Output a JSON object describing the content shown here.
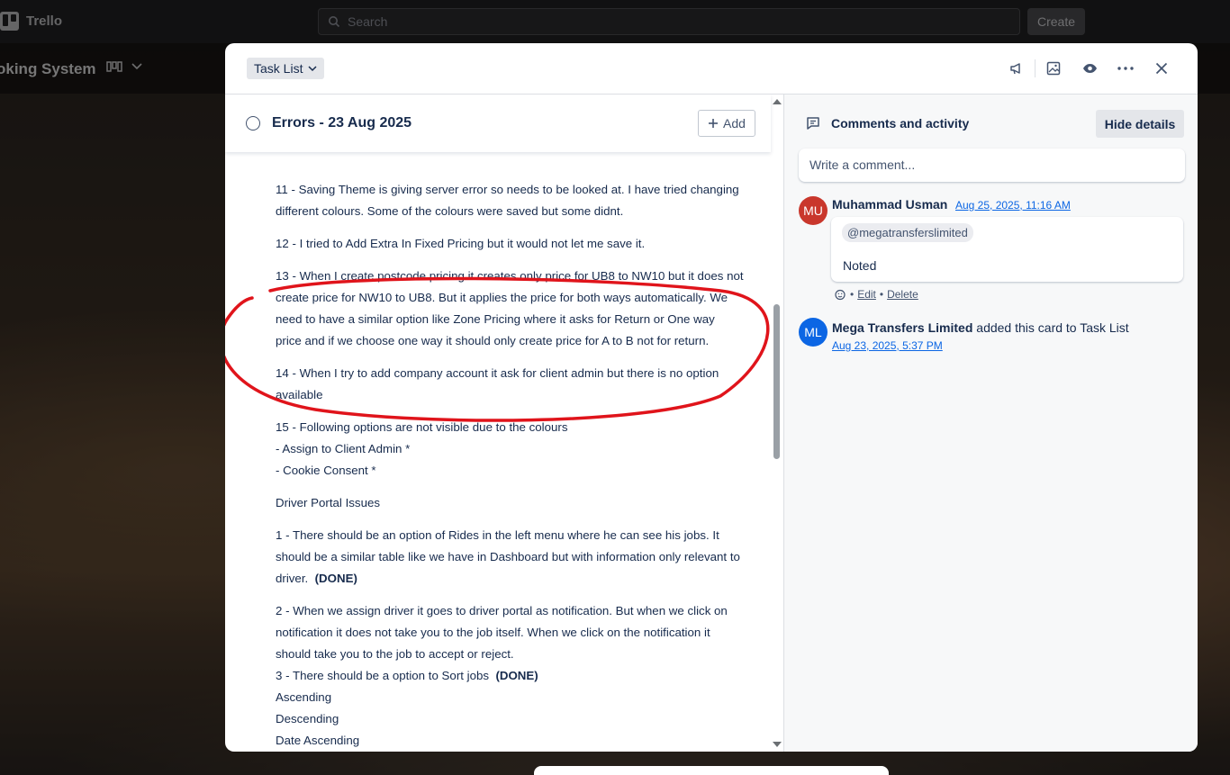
{
  "app": {
    "name": "Trello",
    "search_placeholder": "Search",
    "create_label": "Create"
  },
  "board": {
    "title": "oking System"
  },
  "modal": {
    "list_name": "Task List",
    "card_title": "Errors - 23 Aug 2025",
    "add_label": "Add",
    "description": {
      "p11": "11 - Saving Theme is giving server error so needs to be looked at. I have tried changing different colours. Some of the colours were saved but some didnt.",
      "p12": "12 - I tried to Add Extra In Fixed Pricing but it would not let me save it.",
      "p13": "13 - When I create postcode pricing it creates only price for UB8 to NW10 but it does not create price for NW10 to UB8. But it applies the price for both ways automatically. We need to have a similar option like Zone Pricing where it asks for Return or One way price and if we choose one way it should only create price for A to B not for return.",
      "p14": "14 - When I try to add company account it ask for client admin but there is no option available",
      "p15": "15 - Following options are not visible due to the colours",
      "p15a": "- Assign to Client Admin *",
      "p15b": "- Cookie Consent *",
      "driver_heading": "Driver Portal Issues",
      "d1": "1 - There should be an option of Rides in the left menu where he can see his jobs. It should be a similar table like we have in Dashboard but with information only relevant to driver.",
      "d1_done": "(DONE)",
      "d2": "2 - When we assign driver it goes to driver portal as notification. But when we click on notification it does not take you to the job itself. When we click on the notification it should take you to the job to accept or reject.",
      "d3": "3 - There should be a option to Sort jobs",
      "d3_done": "(DONE)",
      "sort1": "Ascending",
      "sort2": "Descending",
      "sort3": "Date Ascending"
    },
    "activity": {
      "heading": "Comments and activity",
      "hide_label": "Hide details",
      "comment_placeholder": "Write a comment...",
      "comment": {
        "initials": "MU",
        "author": "Muhammad Usman",
        "date": "Aug 25, 2025, 11:16 AM",
        "mention": "@megatransferslimited",
        "text": "Noted",
        "edit": "Edit",
        "delete": "Delete"
      },
      "event": {
        "initials": "ML",
        "actor": "Mega Transfers Limited",
        "action": "added this card to Task List",
        "date": "Aug 23, 2025, 5:37 PM"
      }
    }
  },
  "colors": {
    "accent": "#0c66e4",
    "annotation": "#e0141b",
    "avatar_mu": "#c9372c",
    "avatar_ml": "#0c66e4"
  }
}
